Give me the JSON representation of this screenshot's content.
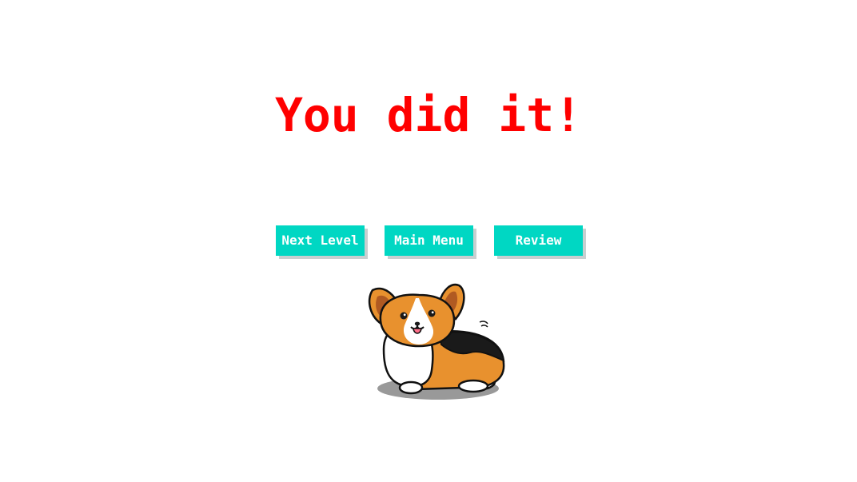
{
  "screen": {
    "title": "You did it!"
  },
  "buttons": {
    "next_level": "Next Level",
    "main_menu": "Main Menu",
    "review": "Review"
  },
  "colors": {
    "title": "#ff0000",
    "button_bg": "#00d7c3",
    "button_text": "#ffffff",
    "button_shadow": "#c8cfd0",
    "corgi_orange": "#e8912e",
    "corgi_black": "#1a1a1a",
    "shadow": "#999999"
  },
  "mascot": {
    "icon": "corgi-mascot"
  }
}
